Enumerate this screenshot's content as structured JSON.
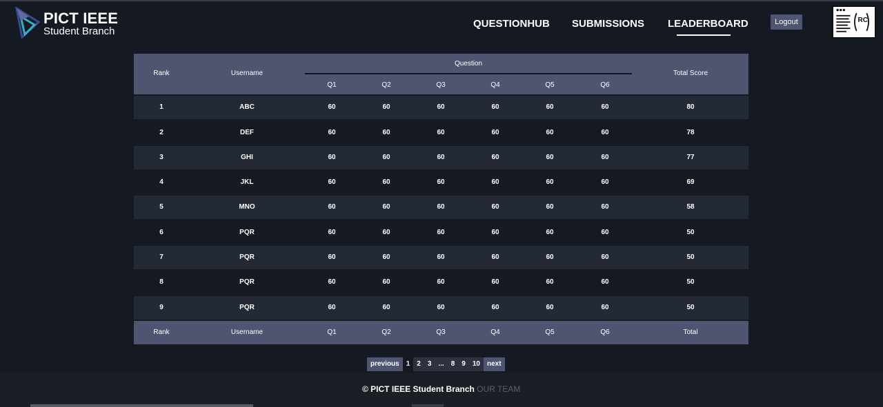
{
  "header": {
    "brand_title": "PICT IEEE",
    "brand_subtitle": "Student Branch",
    "nav": [
      "QUESTIONHUB",
      "SUBMISSIONS",
      "LEADERBOARD"
    ],
    "active_nav": "LEADERBOARD",
    "logout_label": "Logout",
    "logo_icon": "pict-ieee-logo-icon",
    "rc_logo_text": "RC"
  },
  "table": {
    "header": {
      "rank": "Rank",
      "username": "Username",
      "question_group": "Question",
      "questions": [
        "Q1",
        "Q2",
        "Q3",
        "Q4",
        "Q5",
        "Q6"
      ],
      "total": "Total Score"
    },
    "rows": [
      {
        "rank": "1",
        "username": "ABC",
        "scores": [
          "60",
          "60",
          "60",
          "60",
          "60",
          "60"
        ],
        "total": "80"
      },
      {
        "rank": "2",
        "username": "DEF",
        "scores": [
          "60",
          "60",
          "60",
          "60",
          "60",
          "60"
        ],
        "total": "78"
      },
      {
        "rank": "3",
        "username": "GHI",
        "scores": [
          "60",
          "60",
          "60",
          "60",
          "60",
          "60"
        ],
        "total": "77"
      },
      {
        "rank": "4",
        "username": "JKL",
        "scores": [
          "60",
          "60",
          "60",
          "60",
          "60",
          "60"
        ],
        "total": "69"
      },
      {
        "rank": "5",
        "username": "MNO",
        "scores": [
          "60",
          "60",
          "60",
          "60",
          "60",
          "60"
        ],
        "total": "58"
      },
      {
        "rank": "6",
        "username": "PQR",
        "scores": [
          "60",
          "60",
          "60",
          "60",
          "60",
          "60"
        ],
        "total": "50"
      },
      {
        "rank": "7",
        "username": "PQR",
        "scores": [
          "60",
          "60",
          "60",
          "60",
          "60",
          "60"
        ],
        "total": "50"
      },
      {
        "rank": "8",
        "username": "PQR",
        "scores": [
          "60",
          "60",
          "60",
          "60",
          "60",
          "60"
        ],
        "total": "50"
      },
      {
        "rank": "9",
        "username": "PQR",
        "scores": [
          "60",
          "60",
          "60",
          "60",
          "60",
          "60"
        ],
        "total": "50"
      }
    ],
    "footer": {
      "rank": "Rank",
      "username": "Username",
      "questions": [
        "Q1",
        "Q2",
        "Q3",
        "Q4",
        "Q5",
        "Q6"
      ],
      "total": "Total"
    }
  },
  "pagination": {
    "previous": "previous",
    "pages": [
      "1",
      "2",
      "3",
      "...",
      "8",
      "9",
      "10"
    ],
    "current": "1",
    "next": "next"
  },
  "footer": {
    "copyright": "© PICT IEEE Student Branch",
    "team_link": "OUR TEAM"
  },
  "colors": {
    "background": "#151922",
    "table_header": "#4f5571",
    "row_dark": "#232a36",
    "muted_link": "#5a5f6c"
  }
}
